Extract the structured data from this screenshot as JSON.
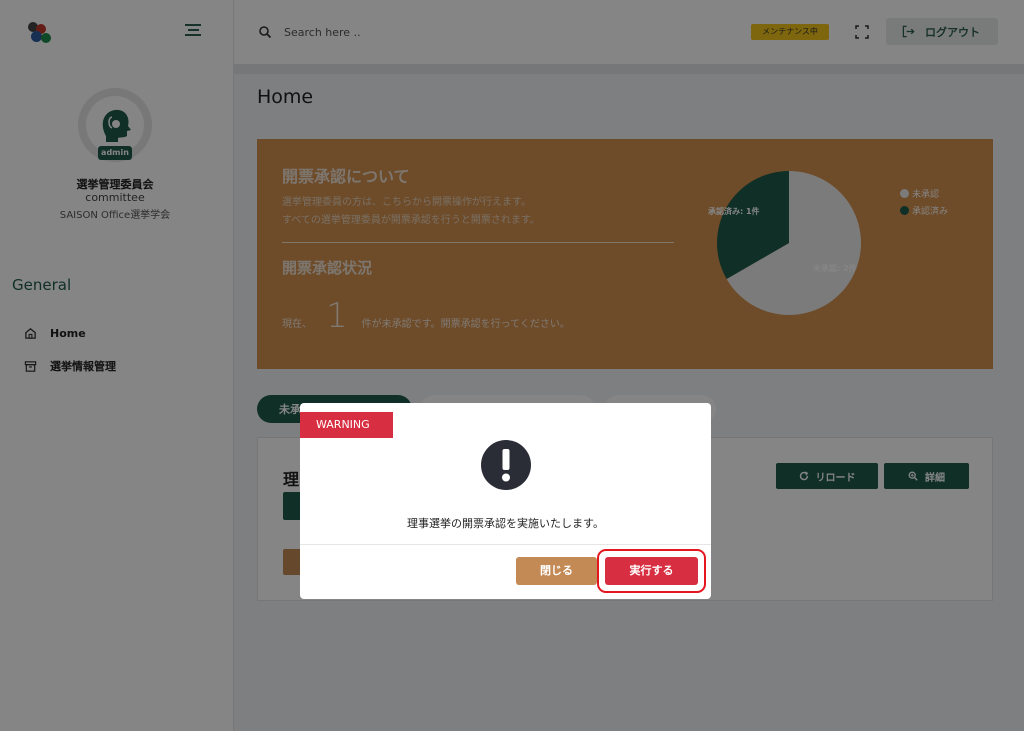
{
  "sidebar": {
    "profile": {
      "badge": "admin",
      "org_name": "選挙管理委員会",
      "role": "committee",
      "org_sub": "SAISON Office選挙学会"
    },
    "section_title": "General",
    "items": [
      {
        "label": "Home",
        "icon": "home-icon"
      },
      {
        "label": "選挙情報管理",
        "icon": "archive-icon"
      }
    ]
  },
  "header": {
    "search_placeholder": "Search here ..",
    "maintenance_badge": "メンテナンス中",
    "logout_label": "ログアウト"
  },
  "main": {
    "page_title": "Home",
    "banner": {
      "heading": "開票承認について",
      "line1": "選挙管理委員の方は、こちらから開票操作が行えます。",
      "line2": "すべての選挙管理委員が開票承認を行うと開票されます。",
      "status_heading": "開票承認状況",
      "status_prefix": "現在、",
      "status_count": "1",
      "status_suffix": "件が未承認です。開票承認を行ってください。"
    },
    "card": {
      "title_partial": "理",
      "reload_label": "リロード",
      "detail_label": "詳細"
    },
    "tabs": [
      {
        "label": "未承"
      }
    ]
  },
  "chart_data": {
    "type": "pie",
    "categories": [
      "未承認",
      "承認済み"
    ],
    "values": [
      2,
      1
    ],
    "data_labels": [
      "未承認: 2件",
      "承認済み: 1件"
    ],
    "colors": [
      "#ececec",
      "#1e5b4c"
    ],
    "legend_position": "right"
  },
  "modal": {
    "tag": "WARNING",
    "message": "理事選挙の開票承認を実施いたします。",
    "close_label": "閉じる",
    "execute_label": "実行する"
  },
  "colors": {
    "primary": "#1e5b4c",
    "banner": "#d4914f",
    "danger": "#d72f41",
    "accent_tan": "#c48a55",
    "maintenance": "#f0c419"
  }
}
